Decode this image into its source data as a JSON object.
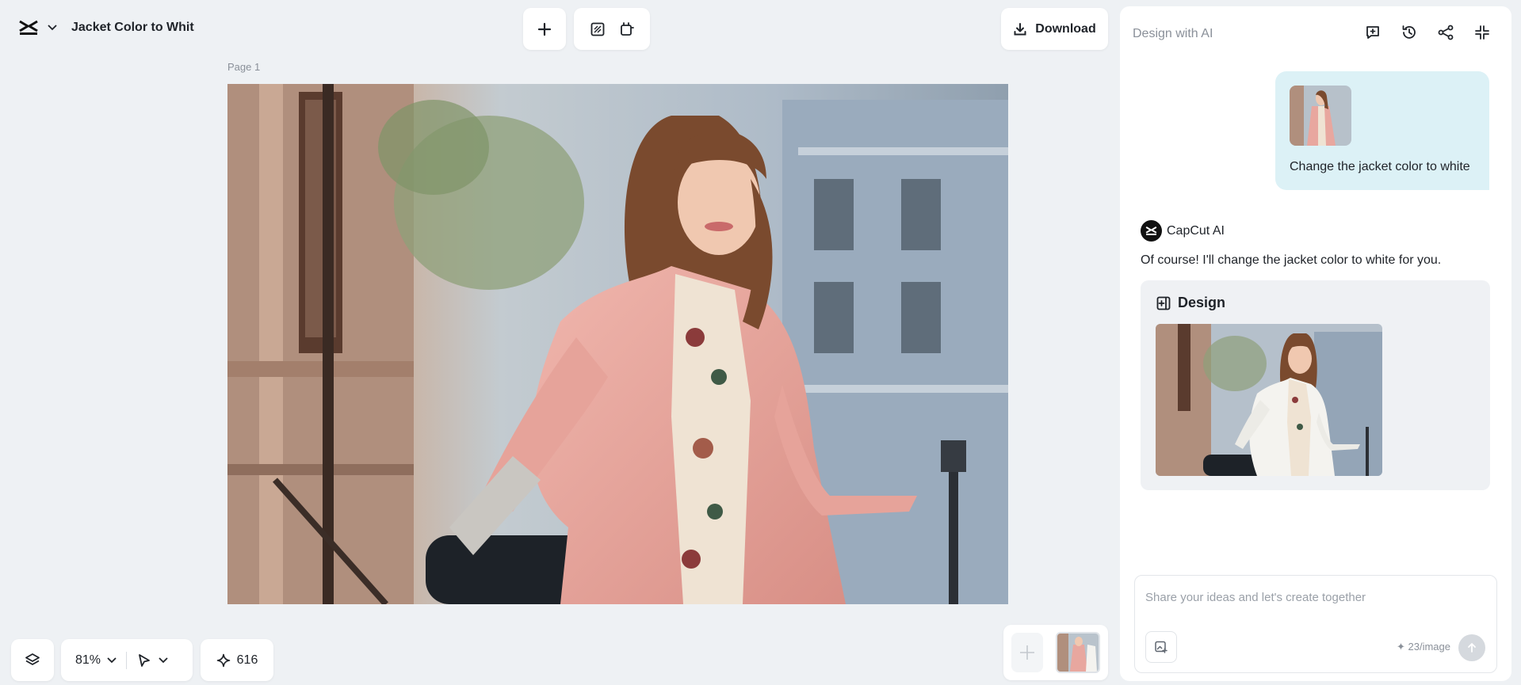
{
  "project": {
    "title": "Jacket Color to Whit"
  },
  "toolbar": {
    "add_icon": "plus-icon",
    "tool_icons": [
      "resize-canvas-icon",
      "crop-page-icon"
    ],
    "download_label": "Download"
  },
  "canvas": {
    "page_label": "Page 1",
    "image_description": "woman-in-pink-coat"
  },
  "bottom_bar": {
    "zoom": "81%",
    "credits": "616"
  },
  "ai_panel": {
    "title": "Design with AI",
    "header_icons": [
      "new-chat-icon",
      "history-icon",
      "share-icon",
      "collapse-icon"
    ],
    "user_message": "Change the jacket color to white",
    "assistant_name": "CapCut AI",
    "assistant_message": "Of course! I'll change the jacket color to white for you.",
    "design_card_label": "Design",
    "input_placeholder": "Share your ideas and let's create together",
    "cost": "✦ 23/image"
  },
  "colors": {
    "background": "#eef1f4",
    "user_bubble": "#dcf1f6",
    "pink_coat": "#e8a79f",
    "white_coat": "#f4f3ef"
  }
}
